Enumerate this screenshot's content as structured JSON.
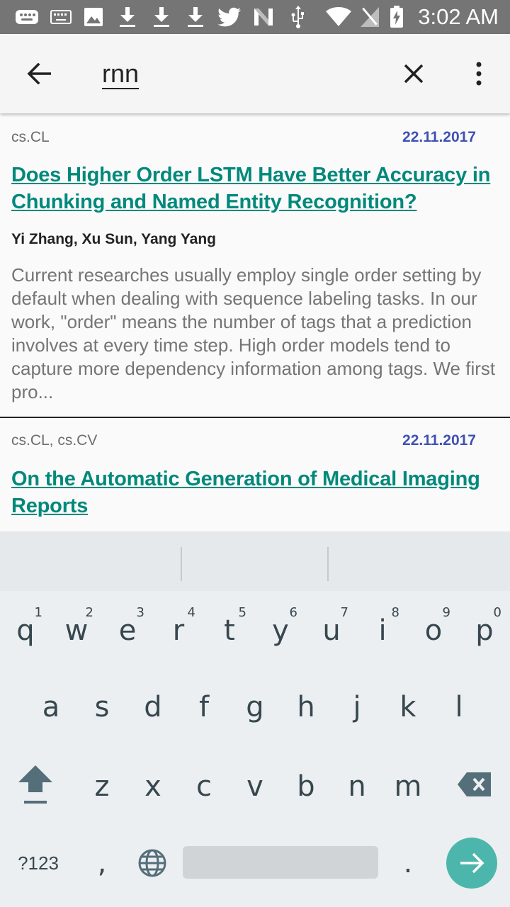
{
  "status_bar": {
    "time": "3:02 AM",
    "icons": [
      "keyboard-status-icon",
      "keyboard-icon",
      "image-icon",
      "download-icon",
      "download-icon",
      "download-icon",
      "twitter-icon",
      "n-icon",
      "usb-icon",
      "wifi-icon",
      "no-signal-icon",
      "battery-charging-icon"
    ]
  },
  "toolbar": {
    "query": "rnn",
    "back_icon": "back-arrow-icon",
    "clear_icon": "close-icon",
    "more_icon": "more-vert-icon"
  },
  "results": [
    {
      "categories": "cs.CL",
      "date": "22.11.2017",
      "title": "Does Higher Order LSTM Have Better Accuracy in Chunking and Named Entity   Recognition?",
      "authors": "Yi Zhang, Xu Sun, Yang Yang",
      "abstract": "Current researches usually employ single order setting by default when dealing with sequence labeling tasks. In our work, \"order\" means the number of tags that a prediction involves at every time step. High order models tend to capture more dependency information among tags. We first pro..."
    },
    {
      "categories": "cs.CL, cs.CV",
      "date": "22.11.2017",
      "title": "On the Automatic Generation of Medical Imaging Reports"
    }
  ],
  "keyboard": {
    "row1": [
      "q",
      "w",
      "e",
      "r",
      "t",
      "y",
      "u",
      "i",
      "o",
      "p"
    ],
    "row1_hints": [
      "1",
      "2",
      "3",
      "4",
      "5",
      "6",
      "7",
      "8",
      "9",
      "0"
    ],
    "row2": [
      "a",
      "s",
      "d",
      "f",
      "g",
      "h",
      "j",
      "k",
      "l"
    ],
    "row3": [
      "z",
      "x",
      "c",
      "v",
      "b",
      "n",
      "m"
    ],
    "symbols_label": "?123",
    "comma": ",",
    "period": ".",
    "shift_icon": "shift-icon",
    "backspace_icon": "backspace-icon",
    "globe_icon": "globe-icon",
    "enter_icon": "enter-arrow-icon"
  },
  "colors": {
    "title": "#00897b",
    "date": "#3f51b5",
    "enter_button": "#4db6ac"
  }
}
